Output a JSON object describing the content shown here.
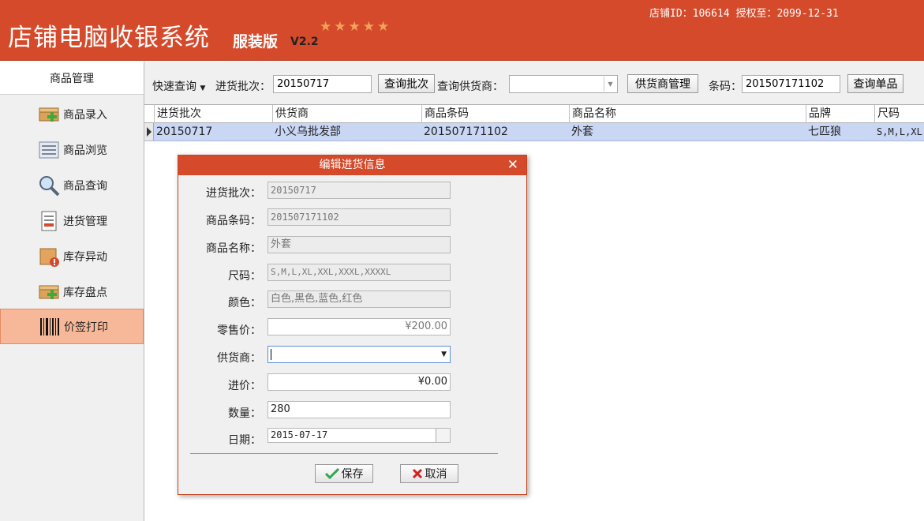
{
  "header": {
    "title": "店铺电脑收银系统",
    "edition": "服装版",
    "version": "V2.2",
    "stars": "★★★★★",
    "shop_info": "店铺ID：106614 授权至：2099-12-31"
  },
  "sidebar": {
    "header": "商品管理",
    "items": [
      {
        "label": "商品录入",
        "icon": "box-add-icon"
      },
      {
        "label": "商品浏览",
        "icon": "list-icon"
      },
      {
        "label": "商品查询",
        "icon": "magnifier-icon"
      },
      {
        "label": "进货管理",
        "icon": "document-icon"
      },
      {
        "label": "库存异动",
        "icon": "box-alert-icon"
      },
      {
        "label": "库存盘点",
        "icon": "box-add-icon"
      },
      {
        "label": "价签打印",
        "icon": "barcode-icon"
      }
    ]
  },
  "toolbar": {
    "quick_query": "快速查询",
    "batch_label": "进货批次：",
    "batch_value": "20150717",
    "query_batch_btn": "查询批次",
    "supplier_label": "查询供货商：",
    "supplier_value": "",
    "supplier_mgmt_btn": "供货商管理",
    "barcode_label": "条码：",
    "barcode_value": "201507171102",
    "query_item_btn": "查询单品"
  },
  "grid": {
    "columns": [
      "进货批次",
      "供货商",
      "商品条码",
      "商品名称",
      "品牌",
      "尺码"
    ],
    "rows": [
      [
        "20150717",
        "小义乌批发部",
        "201507171102",
        "外套",
        "七匹狼",
        "S,M,L,XL,"
      ]
    ]
  },
  "dialog": {
    "title": "编辑进货信息",
    "close": "✕",
    "fields": {
      "batch": {
        "label": "进货批次：",
        "value": "20150717"
      },
      "barcode": {
        "label": "商品条码：",
        "value": "201507171102"
      },
      "name": {
        "label": "商品名称：",
        "value": "外套"
      },
      "size": {
        "label": "尺码：",
        "value": "S,M,L,XL,XXL,XXXL,XXXXL"
      },
      "color": {
        "label": "颜色：",
        "value": "白色,黑色,蓝色,红色"
      },
      "retail": {
        "label": "零售价：",
        "value": "¥200.00"
      },
      "supplier": {
        "label": "供货商：",
        "value": ""
      },
      "cost": {
        "label": "进价：",
        "value": "¥0.00"
      },
      "qty": {
        "label": "数量：",
        "value": "280"
      },
      "date": {
        "label": "日期：",
        "value": "2015-07-17"
      }
    },
    "save_btn": "保存",
    "cancel_btn": "取消"
  },
  "colors": {
    "accent": "#d54a2b",
    "selected_row": "#c9d7f5",
    "active_side": "#f7b89a"
  }
}
